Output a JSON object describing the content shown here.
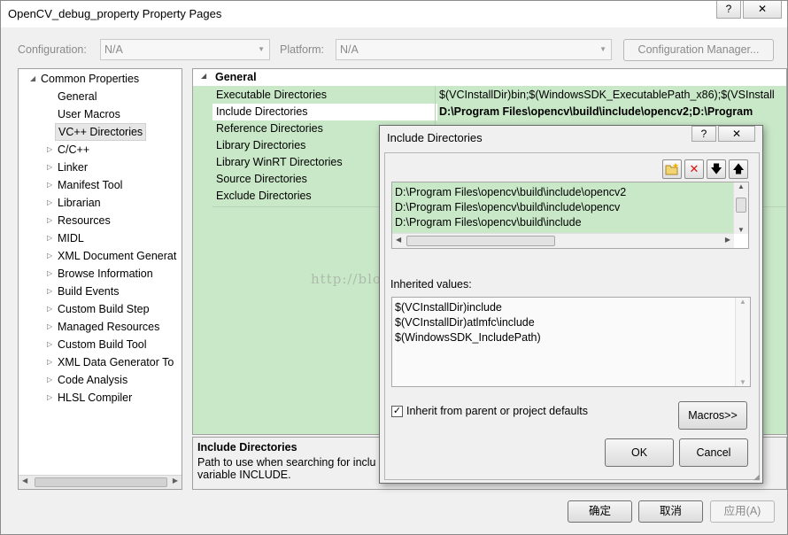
{
  "window": {
    "title": "OpenCV_debug_property Property Pages",
    "help_glyph": "?",
    "close_glyph": "✕"
  },
  "toolbar": {
    "configuration_label": "Configuration:",
    "configuration_value": "N/A",
    "platform_label": "Platform:",
    "platform_value": "N/A",
    "config_manager_label": "Configuration Manager..."
  },
  "tree": {
    "root": "Common Properties",
    "items": [
      {
        "label": "General",
        "expandable": false
      },
      {
        "label": "User Macros",
        "expandable": false
      },
      {
        "label": "VC++ Directories",
        "expandable": false,
        "selected": true
      },
      {
        "label": "C/C++",
        "expandable": true
      },
      {
        "label": "Linker",
        "expandable": true
      },
      {
        "label": "Manifest Tool",
        "expandable": true
      },
      {
        "label": "Librarian",
        "expandable": true
      },
      {
        "label": "Resources",
        "expandable": true
      },
      {
        "label": "MIDL",
        "expandable": true
      },
      {
        "label": "XML Document Generat",
        "expandable": true
      },
      {
        "label": "Browse Information",
        "expandable": true
      },
      {
        "label": "Build Events",
        "expandable": true
      },
      {
        "label": "Custom Build Step",
        "expandable": true
      },
      {
        "label": "Managed Resources",
        "expandable": true
      },
      {
        "label": "Custom Build Tool",
        "expandable": true
      },
      {
        "label": "XML Data Generator To",
        "expandable": true
      },
      {
        "label": "Code Analysis",
        "expandable": true
      },
      {
        "label": "HLSL Compiler",
        "expandable": true
      }
    ]
  },
  "grid": {
    "section": "General",
    "rows": [
      {
        "name": "Executable Directories",
        "value": "$(VCInstallDir)bin;$(WindowsSDK_ExecutablePath_x86);$(VSInstall",
        "bold": false
      },
      {
        "name": "Include Directories",
        "value": "D:\\Program Files\\opencv\\build\\include\\opencv2;D:\\Program",
        "bold": true
      },
      {
        "name": "Reference Directories",
        "value": "",
        "bold": false
      },
      {
        "name": "Library Directories",
        "value": "",
        "bold": false
      },
      {
        "name": "Library WinRT Directories",
        "value": "",
        "bold": false
      },
      {
        "name": "Source Directories",
        "value": "",
        "bold": false
      },
      {
        "name": "Exclude Directories",
        "value": "",
        "bold": false
      }
    ]
  },
  "description": {
    "title": "Include Directories",
    "line1": "Path to use when searching for inclu",
    "line2": "variable INCLUDE."
  },
  "dialog": {
    "title": "Include Directories",
    "help_glyph": "?",
    "close_glyph": "✕",
    "entries": [
      "D:\\Program Files\\opencv\\build\\include\\opencv2",
      "D:\\Program Files\\opencv\\build\\include\\opencv",
      "D:\\Program Files\\opencv\\build\\include"
    ],
    "inherited_label": "Inherited values:",
    "inherited": [
      "$(VCInstallDir)include",
      "$(VCInstallDir)atlmfc\\include",
      "$(WindowsSDK_IncludePath)"
    ],
    "inherit_checkbox_label": "Inherit from parent or project defaults",
    "inherit_checked": true,
    "macros_label": "Macros>>",
    "ok_label": "OK",
    "cancel_label": "Cancel"
  },
  "footer": {
    "ok_label": "确定",
    "cancel_label": "取消",
    "apply_label": "应用(A)"
  },
  "watermark": "http://blog.csdn.net/",
  "colors": {
    "accent_green": "#c9e8c8",
    "selection_gray": "#e6e6e6"
  }
}
